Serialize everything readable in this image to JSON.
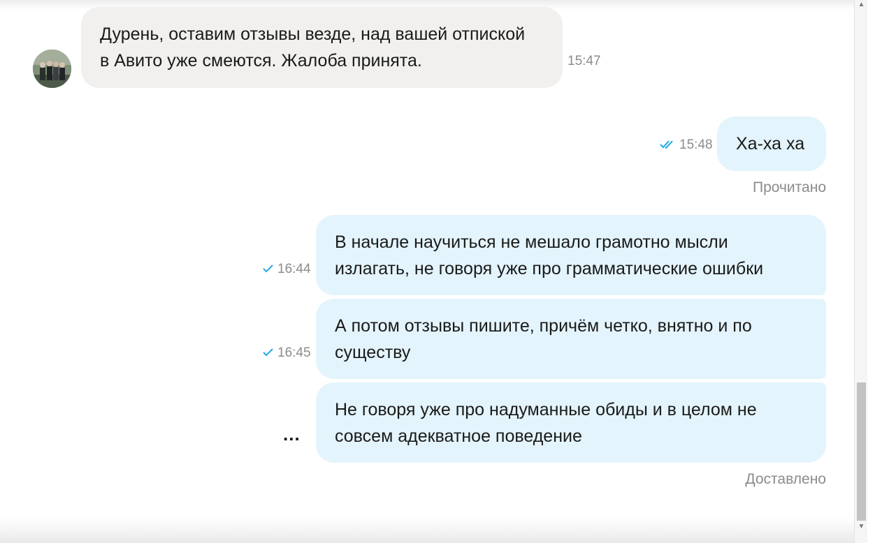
{
  "messages": {
    "incoming_1": {
      "text": "Дурень, оставим отзывы везде, над вашей отпиской в Авито уже смеются. Жалоба принята.",
      "time": "15:47"
    },
    "outgoing_1": {
      "text": "Ха-ха ха",
      "time": "15:48",
      "check": "double-check-icon"
    },
    "read_status": "Прочитано",
    "outgoing_2": {
      "text": "В начале научиться не мешало грамотно мысли излагать, не говоря уже про грамматические ошибки",
      "time": "16:44",
      "check": "single-check-icon"
    },
    "outgoing_3": {
      "text": "А потом отзывы пишите, причём четко, внятно и по существу",
      "time": "16:45",
      "check": "single-check-icon"
    },
    "outgoing_4": {
      "text": "Не говоря уже про надуманные обиды и в целом не совсем адекватное поведение",
      "pending": "..."
    },
    "delivered_status": "Доставлено"
  },
  "colors": {
    "incoming_bubble": "#f1f0ee",
    "outgoing_bubble": "#e3f4fc",
    "check_blue": "#1ea7e4",
    "meta_gray": "#8b8b8b"
  }
}
